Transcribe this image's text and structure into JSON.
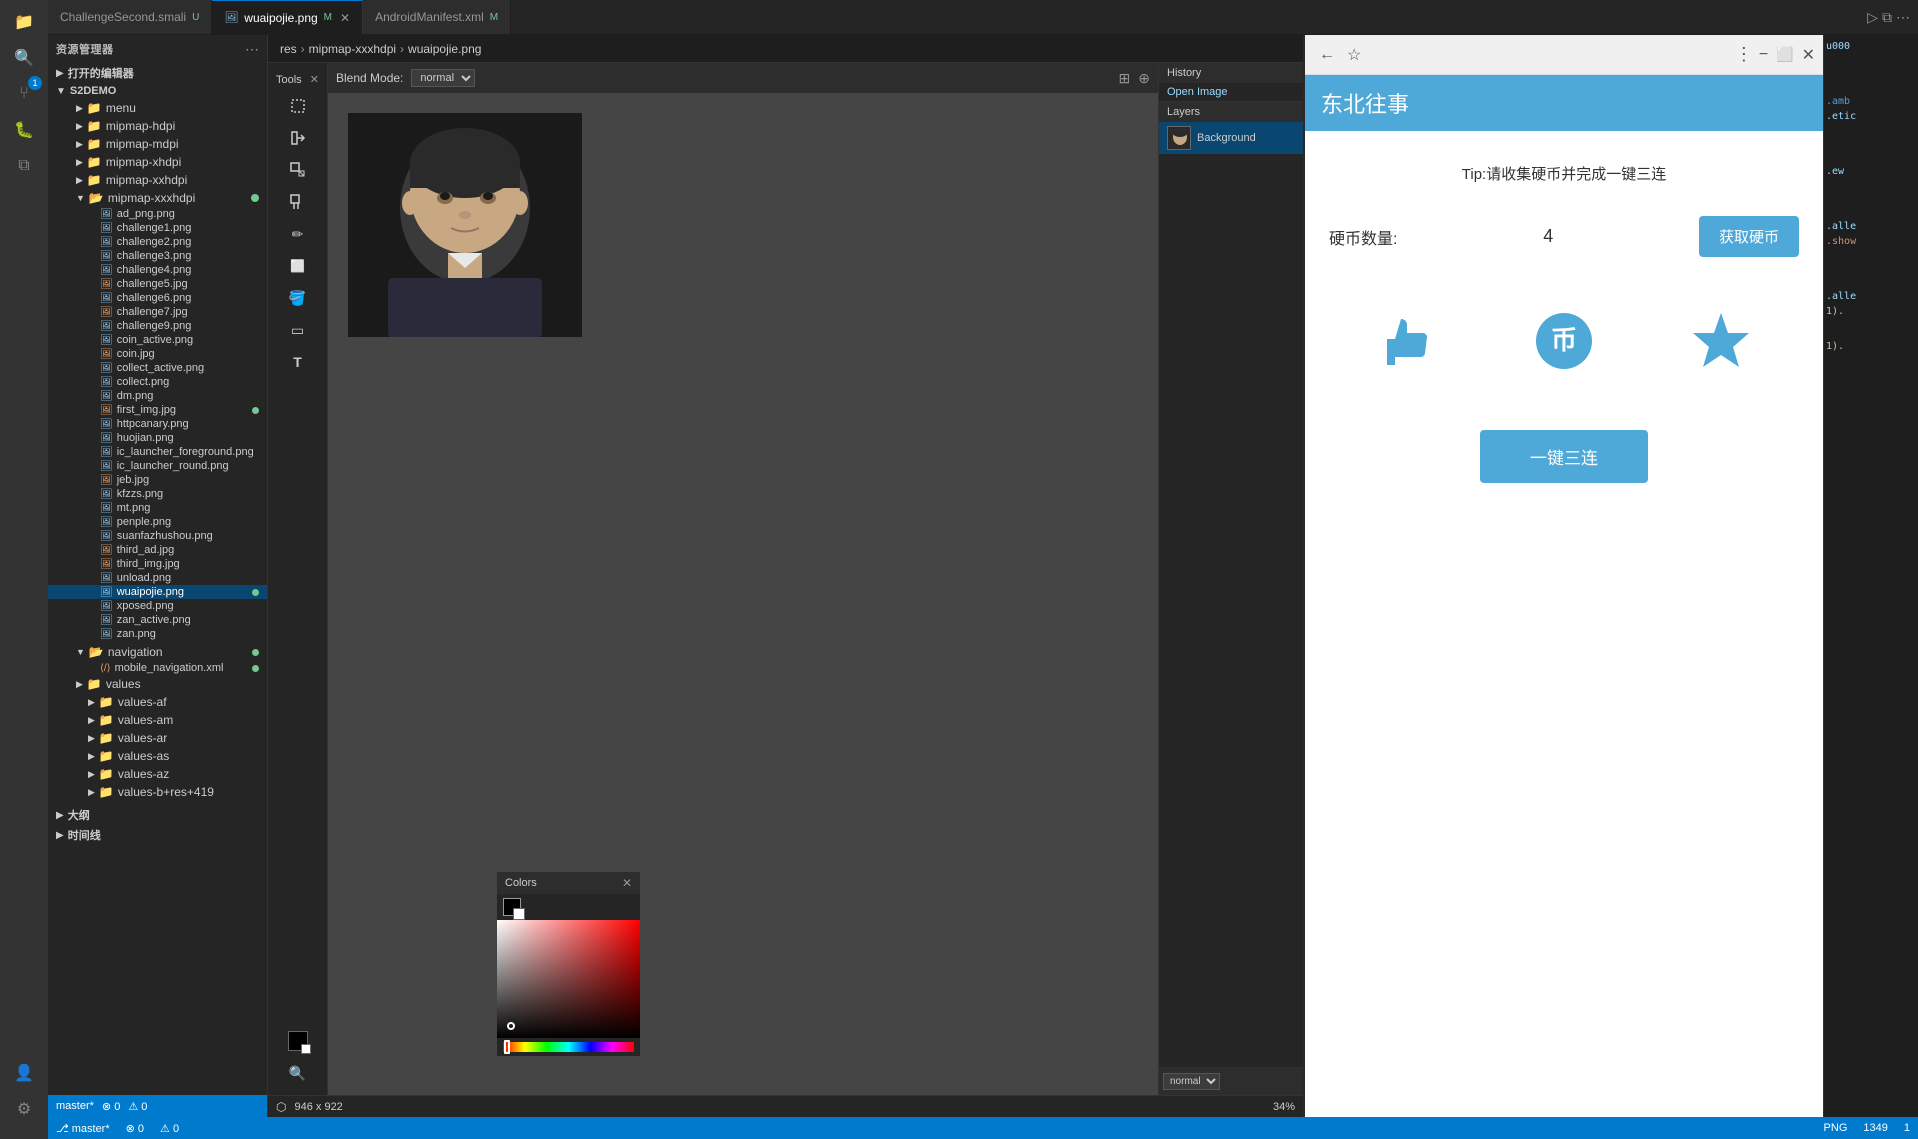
{
  "window": {
    "title": "资源管理器"
  },
  "sidebar": {
    "top_label": "资源管理器",
    "expand_label": "打开的编辑器",
    "project": "S2DEMO",
    "folders": [
      {
        "name": "menu",
        "indent": 1
      },
      {
        "name": "mipmap-hdpi",
        "indent": 1
      },
      {
        "name": "mipmap-mdpi",
        "indent": 1
      },
      {
        "name": "mipmap-xhdpi",
        "indent": 1
      },
      {
        "name": "mipmap-xxhdpi",
        "indent": 1
      },
      {
        "name": "mipmap-xxxhdpi",
        "indent": 1,
        "expanded": true
      }
    ],
    "files": [
      {
        "name": "ad_png.png",
        "indent": 2
      },
      {
        "name": "challenge1.png",
        "indent": 2
      },
      {
        "name": "challenge2.png",
        "indent": 2
      },
      {
        "name": "challenge3.png",
        "indent": 2
      },
      {
        "name": "challenge4.png",
        "indent": 2
      },
      {
        "name": "challenge5.jpg",
        "indent": 2
      },
      {
        "name": "challenge6.png",
        "indent": 2
      },
      {
        "name": "challenge7.jpg",
        "indent": 2
      },
      {
        "name": "challenge9.png",
        "indent": 2
      },
      {
        "name": "coin_active.png",
        "indent": 2
      },
      {
        "name": "coin.jpg",
        "indent": 2
      },
      {
        "name": "collect_active.png",
        "indent": 2
      },
      {
        "name": "collect.png",
        "indent": 2
      },
      {
        "name": "dm.png",
        "indent": 2
      },
      {
        "name": "first_img.jpg",
        "indent": 2,
        "modified": true
      },
      {
        "name": "httpcanary.png",
        "indent": 2
      },
      {
        "name": "huojian.png",
        "indent": 2
      },
      {
        "name": "ic_launcher_foreground.png",
        "indent": 2
      },
      {
        "name": "ic_launcher_round.png",
        "indent": 2
      },
      {
        "name": "jeb.jpg",
        "indent": 2
      },
      {
        "name": "kfzzs.png",
        "indent": 2
      },
      {
        "name": "mt.png",
        "indent": 2
      },
      {
        "name": "penple.png",
        "indent": 2
      },
      {
        "name": "suanfazhushou.png",
        "indent": 2
      },
      {
        "name": "third_ad.jpg",
        "indent": 2
      },
      {
        "name": "third_img.jpg",
        "indent": 2
      },
      {
        "name": "unload.png",
        "indent": 2
      },
      {
        "name": "wuaipojie.png",
        "indent": 2,
        "selected": true,
        "modified": true
      },
      {
        "name": "xposed.png",
        "indent": 2
      },
      {
        "name": "zan_active.png",
        "indent": 2
      },
      {
        "name": "zan.png",
        "indent": 2
      }
    ],
    "navigation_folder": "navigation",
    "nav_files": [
      {
        "name": "mobile_navigation.xml",
        "indent": 2,
        "modified": true
      }
    ],
    "values_folder": "values",
    "values_sub": [
      "values-af",
      "values-am",
      "values-ar",
      "values-as",
      "values-az",
      "values-b+res+419"
    ],
    "bottom": {
      "branch": "master*",
      "errors": "0",
      "warnings": "0"
    }
  },
  "tabs": [
    {
      "label": "ChallengeSecond.smali",
      "suffix": "U",
      "active": false,
      "closable": false
    },
    {
      "label": "wuaipojie.png",
      "suffix": "M",
      "active": true,
      "closable": true
    },
    {
      "label": "AndroidManifest.xml",
      "suffix": "M",
      "active": false,
      "closable": false
    }
  ],
  "breadcrumb": {
    "parts": [
      "res",
      "mipmap-xxxhdpi",
      "wuaipojie.png"
    ]
  },
  "image_editor": {
    "tools_label": "Tools",
    "blend_mode_label": "Blend Mode:",
    "blend_mode_value": "normal",
    "history_label": "History",
    "history_item": "Open Image",
    "layers_label": "Layers",
    "layer_name": "Background",
    "layer_blend": "normal",
    "canvas_size": "946 x 922",
    "zoom": "34%",
    "dimensions_label": "946 x 922"
  },
  "colors_panel": {
    "title": "Colors"
  },
  "phone_preview": {
    "app_title": "东北往事",
    "tip_text": "Tip:请收集硬币并完成一键三连",
    "coin_label": "硬币数量:",
    "coin_count": "4",
    "get_coin_btn": "获取硬币",
    "triple_btn": "一键三连",
    "icons": {
      "thumb_up": "👍",
      "coin_icon": "币",
      "star_icon": "⭐"
    }
  },
  "status_bar": {
    "branch": "⎇ master*",
    "errors": "⊗ 0",
    "warnings": "⚠ 0",
    "encoding": "PNG",
    "right_items": [
      "PNG",
      "1349",
      "1"
    ]
  }
}
